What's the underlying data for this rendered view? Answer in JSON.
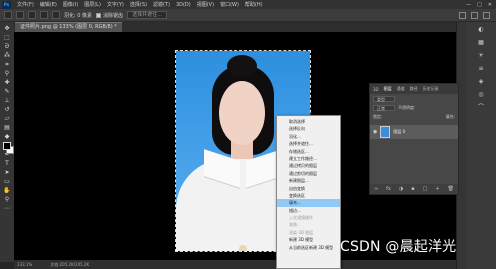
{
  "menubar": {
    "logo": "Ps",
    "items": [
      "文件(F)",
      "编辑(E)",
      "图像(I)",
      "图层(L)",
      "文字(Y)",
      "选择(S)",
      "滤镜(T)",
      "3D(D)",
      "视图(V)",
      "窗口(W)",
      "帮助(H)"
    ],
    "controls": [
      "—",
      "□",
      "✕"
    ]
  },
  "optbar": {
    "feather_label": "羽化: 0 像素",
    "antialias_label": "消除锯齿",
    "style_label": "样式: 正常",
    "width_label": "宽度:",
    "height_label": "高度:",
    "select_subject": "选择并遮住..."
  },
  "doctab": {
    "title": "证件照片.png @ 133% (图层 0, RGB/8) *"
  },
  "statusbar": {
    "zoom": "133.1%",
    "doc_info": "文档:205.2K/205.2K"
  },
  "layers": {
    "tabs": [
      "3D",
      "图层",
      "通道",
      "路径",
      "历史记录"
    ],
    "kind_label": "类型",
    "blend_mode": "正常",
    "opacity_label": "不透明度:",
    "lock_label": "锁定:",
    "fill_label": "填充:",
    "layer_name": "图层 0",
    "footer_icons": [
      "∞",
      "fx",
      "◑",
      "▪",
      "□",
      "+",
      "🗑"
    ]
  },
  "context_menu": {
    "items": [
      {
        "label": "取消选择",
        "state": "normal"
      },
      {
        "label": "选择反向",
        "state": "normal"
      },
      {
        "label": "羽化...",
        "state": "normal"
      },
      {
        "label": "选择并遮住...",
        "state": "normal"
      },
      {
        "label": "存储选区...",
        "state": "normal"
      },
      {
        "label": "建立工作路径...",
        "state": "normal"
      },
      {
        "label": "通过拷贝的图层",
        "state": "normal"
      },
      {
        "label": "通过剪切的图层",
        "state": "normal"
      },
      {
        "label": "新建图层...",
        "state": "normal"
      },
      {
        "label": "自由变换",
        "state": "normal"
      },
      {
        "label": "变换选区",
        "state": "normal"
      },
      {
        "label": "填充...",
        "state": "highlight"
      },
      {
        "label": "描边...",
        "state": "normal"
      },
      {
        "label": "上次滤镜操作",
        "state": "disabled"
      },
      {
        "label": "渐隐...",
        "state": "disabled"
      },
      {
        "label": "渲染 3D 图层",
        "state": "disabled"
      },
      {
        "label": "新建 3D 模型",
        "state": "normal"
      },
      {
        "label": "从当前选区新建 3D 模型",
        "state": "normal"
      }
    ]
  },
  "watermark": "CSDN @晨起洋光"
}
